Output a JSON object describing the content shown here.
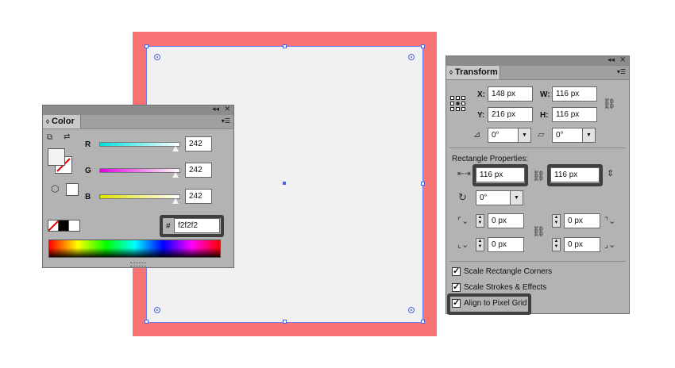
{
  "color_panel": {
    "tab_label": "Color",
    "channels": [
      {
        "name": "R",
        "value": "242",
        "gradient": [
          "#00e0e0",
          "#ffffff"
        ]
      },
      {
        "name": "G",
        "value": "242",
        "gradient": [
          "#e000e0",
          "#ffffff"
        ]
      },
      {
        "name": "B",
        "value": "242",
        "gradient": [
          "#e0e000",
          "#ffffff"
        ]
      }
    ],
    "hex_prefix": "#",
    "hex_value": "f2f2f2",
    "fill_color": "#f2f2f2",
    "panel_controls": {
      "collapse": "◂◂",
      "close": "✕",
      "menu": "▾☰"
    }
  },
  "transform_panel": {
    "tab_label": "Transform",
    "panel_controls": {
      "collapse": "◂◂",
      "close": "✕",
      "menu": "▾☰"
    },
    "x_label": "X:",
    "x_value": "148 px",
    "y_label": "Y:",
    "y_value": "216 px",
    "w_label": "W:",
    "w_value": "116 px",
    "h_label": "H:",
    "h_value": "116 px",
    "rotate_value": "0°",
    "shear_value": "0°",
    "rect_props_title": "Rectangle Properties:",
    "rect_width": "116 px",
    "rect_height": "116 px",
    "rect_rotate": "0°",
    "corner_tl": "0 px",
    "corner_tr": "0 px",
    "corner_bl": "0 px",
    "corner_br": "0 px",
    "options": [
      {
        "label": "Scale Rectangle Corners",
        "checked": true
      },
      {
        "label": "Scale Strokes & Effects",
        "checked": true
      },
      {
        "label": "Align to Pixel Grid",
        "checked": true
      }
    ]
  },
  "canvas": {
    "artboard_color": "#f87474",
    "rect_fill": "#f1f1f1",
    "selection_color": "#4a64e0"
  }
}
